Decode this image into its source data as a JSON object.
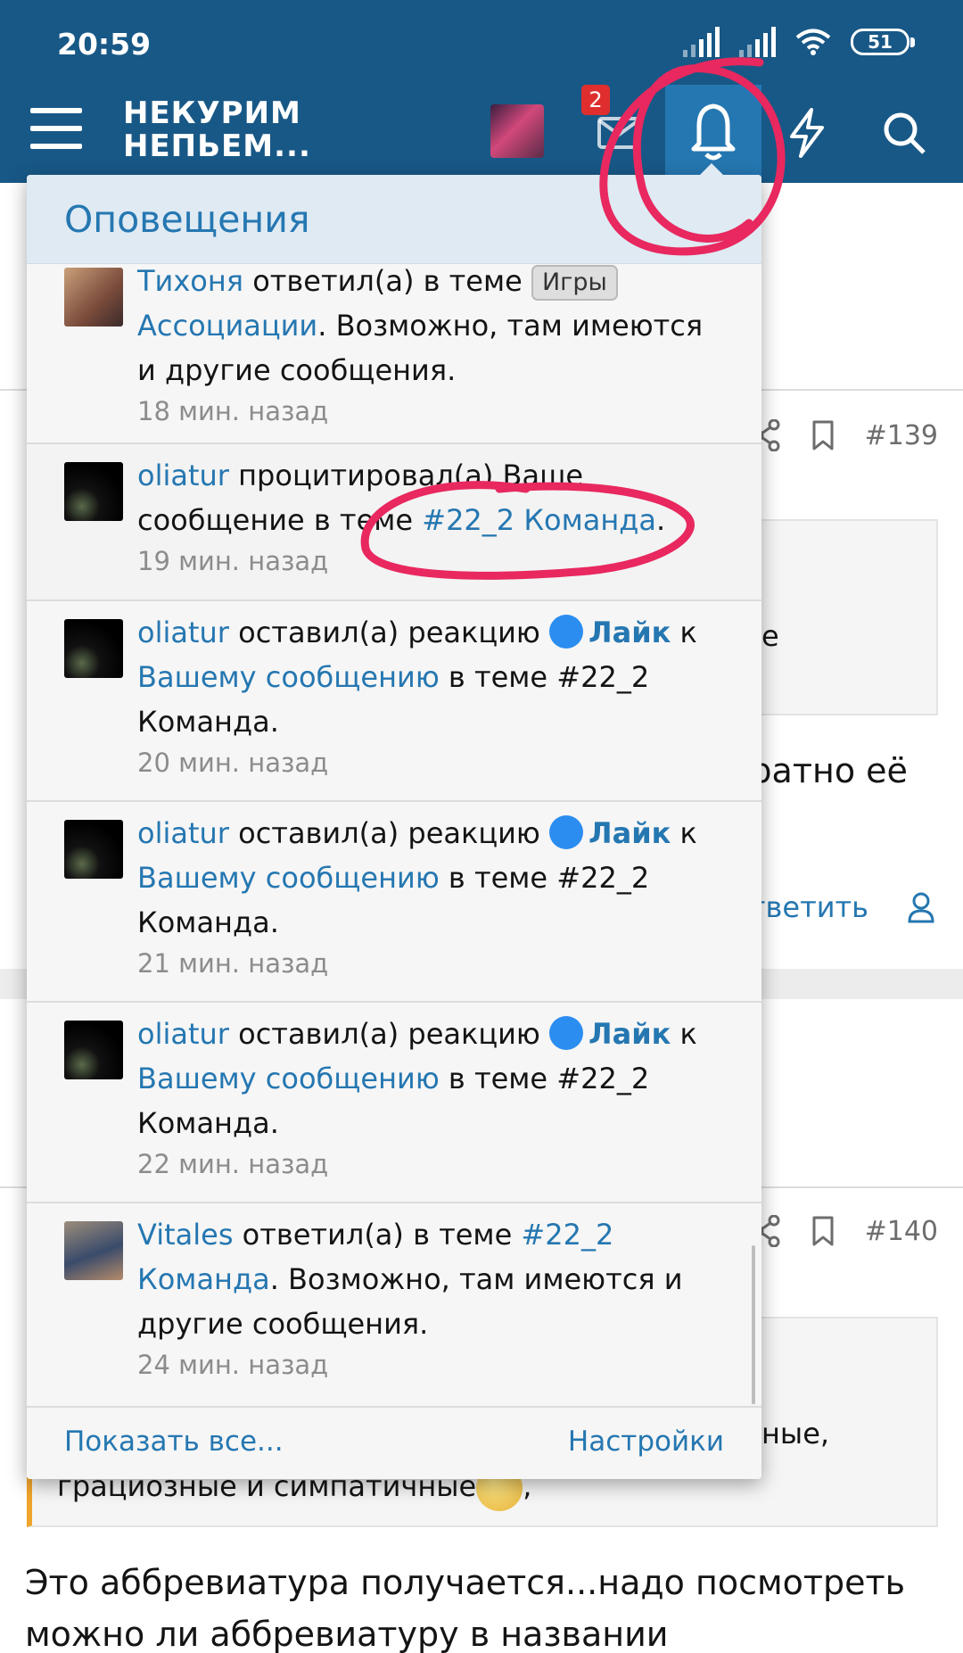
{
  "status_bar": {
    "time": "20:59",
    "battery": "51"
  },
  "header": {
    "logo_line1": "НЕКУРИМ",
    "logo_line2": "НЕПЬЕМ...",
    "conversations_badge": "2"
  },
  "background": {
    "post_number_1": "#139",
    "post_number_2": "#140",
    "quote_fragment_1": "е",
    "text_fragment_1": "братно её",
    "reply_label": "тветить",
    "quote_fragment_2": "ные,",
    "quote_line_2": "грациозные и симпатичные",
    "quote_line_2_end": ",",
    "body_line_1": "Это аббревиатура получается...надо посмотреть",
    "body_line_2": "можно ли аббревиатуру в названии"
  },
  "popup": {
    "title": "Оповещения",
    "show_all": "Показать все...",
    "settings": "Настройки"
  },
  "notifications": [
    {
      "user": "Тихоня",
      "action": " ответил(а) в теме ",
      "tag": "Игры",
      "thread": "Ассоциации",
      "suffix": ". Возможно, там имеются и другие сообщения.",
      "time": "18 мин. назад"
    },
    {
      "user": "oliatur",
      "action": " процитировал(а) Ваше сообщение в теме ",
      "thread": "#22_2 Команда",
      "suffix": ".",
      "time": "19 мин. назад"
    },
    {
      "user": "oliatur",
      "action": " оставил(а) реакцию ",
      "reaction": "Лайк",
      "to": " к ",
      "target": "Вашему сообщению",
      "suffix": " в теме #22_2 Команда.",
      "time": "20 мин. назад"
    },
    {
      "user": "oliatur",
      "action": " оставил(а) реакцию ",
      "reaction": "Лайк",
      "to": " к ",
      "target": "Вашему сообщению",
      "suffix": " в теме #22_2 Команда.",
      "time": "21 мин. назад"
    },
    {
      "user": "oliatur",
      "action": " оставил(а) реакцию ",
      "reaction": "Лайк",
      "to": " к ",
      "target": "Вашему сообщению",
      "suffix": " в теме #22_2 Команда.",
      "time": "22 мин. назад"
    },
    {
      "user": "Vitales",
      "action": " ответил(а) в теме ",
      "thread": "#22_2 Команда",
      "suffix": ". Возможно, там имеются и другие сообщения.",
      "time": "24 мин. назад"
    }
  ],
  "colors": {
    "header_bg": "#185886",
    "accent": "#2577b1",
    "badge": "#e02e2e",
    "annotation": "#e8285f"
  }
}
